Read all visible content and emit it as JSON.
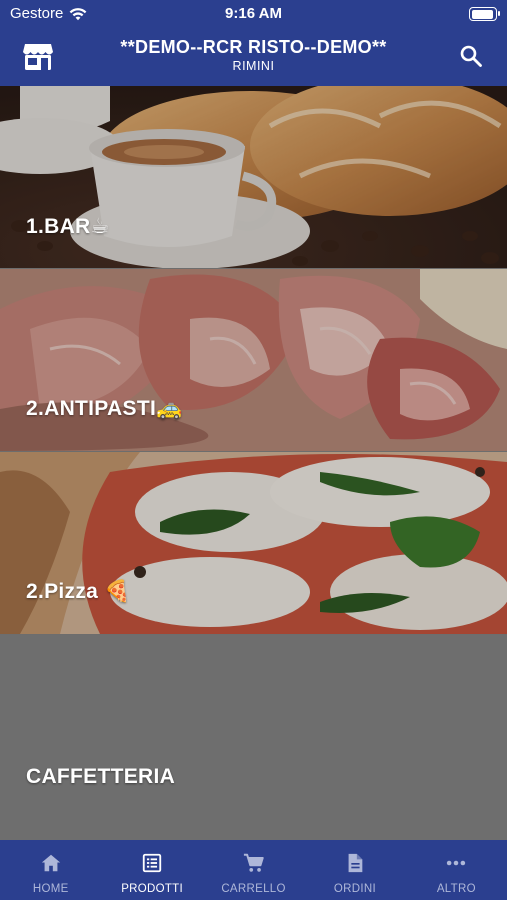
{
  "status_bar": {
    "carrier": "Gestore",
    "time": "9:16 AM",
    "battery_level": 0.95
  },
  "header": {
    "title": "**DEMO--RCR RISTO--DEMO**",
    "subtitle": "RIMINI",
    "left_icon": "store-icon",
    "right_icon": "search-icon",
    "background_color": "#2b3f8f"
  },
  "categories": [
    {
      "label": "1.BAR☕",
      "image": "coffee-and-croissants-photo"
    },
    {
      "label": "2.ANTIPASTI🚕",
      "image": "cured-meats-photo"
    },
    {
      "label": "2.Pizza 🍕",
      "image": "margherita-pizza-photo"
    },
    {
      "label": "CAFFETTERIA",
      "image": ""
    }
  ],
  "tab_bar": {
    "active": "PRODOTTI",
    "tabs": [
      {
        "label": "HOME",
        "icon": "home-icon"
      },
      {
        "label": "PRODOTTI",
        "icon": "list-icon"
      },
      {
        "label": "CARRELLO",
        "icon": "cart-icon"
      },
      {
        "label": "ORDINI",
        "icon": "document-icon"
      },
      {
        "label": "ALTRO",
        "icon": "more-icon"
      }
    ]
  }
}
